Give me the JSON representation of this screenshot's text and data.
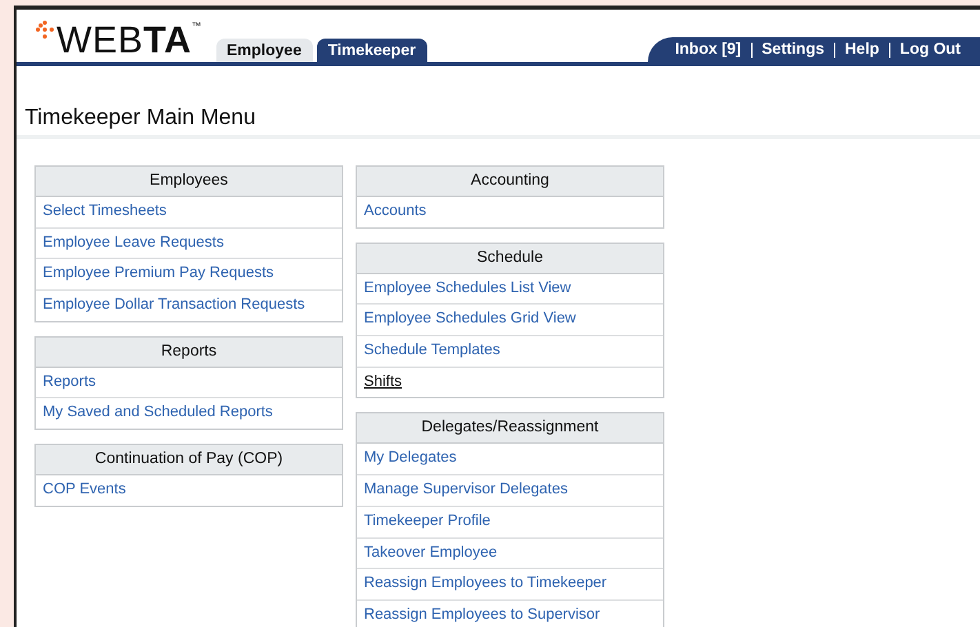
{
  "logo": {
    "text": "WEB**TA**$^{™}$"
  },
  "tabs": [
    {
      "label": "Employee",
      "selected": false
    },
    {
      "label": "Timekeeper",
      "selected": true
    }
  ],
  "top_links": [
    "Inbox [9]",
    "Settings",
    "Help",
    "Log Out"
  ],
  "page_title": "Timekeeper Main Menu",
  "columns": [
    [
      {
        "title": "Employees",
        "items": [
          {
            "label": "Select Timesheets",
            "hovered": false
          },
          {
            "label": "Employee Leave Requests",
            "hovered": false
          },
          {
            "label": "Employee Premium Pay Requests",
            "hovered": false
          },
          {
            "label": "Employee Dollar Transaction Requests",
            "hovered": false
          }
        ]
      },
      {
        "title": "Reports",
        "items": [
          {
            "label": "Reports",
            "hovered": false
          },
          {
            "label": "My Saved and Scheduled Reports",
            "hovered": false
          }
        ]
      },
      {
        "title": "Continuation of Pay (COP)",
        "items": [
          {
            "label": "COP Events",
            "hovered": false
          }
        ]
      }
    ],
    [
      {
        "title": "Accounting",
        "items": [
          {
            "label": "Accounts",
            "hovered": false
          }
        ]
      },
      {
        "title": "Schedule",
        "items": [
          {
            "label": "Employee Schedules List View",
            "hovered": false
          },
          {
            "label": "Employee Schedules Grid View",
            "hovered": false
          },
          {
            "label": "Schedule Templates",
            "hovered": false
          },
          {
            "label": "Shifts",
            "hovered": true
          }
        ]
      },
      {
        "title": "Delegates/Reassignment",
        "items": [
          {
            "label": "My Delegates",
            "hovered": false
          },
          {
            "label": "Manage Supervisor Delegates",
            "hovered": false
          },
          {
            "label": "Timekeeper Profile",
            "hovered": false
          },
          {
            "label": "Takeover Employee",
            "hovered": false
          },
          {
            "label": "Reassign Employees to Timekeeper",
            "hovered": false
          },
          {
            "label": "Reassign Employees to Supervisor",
            "hovered": false
          }
        ]
      }
    ]
  ]
}
